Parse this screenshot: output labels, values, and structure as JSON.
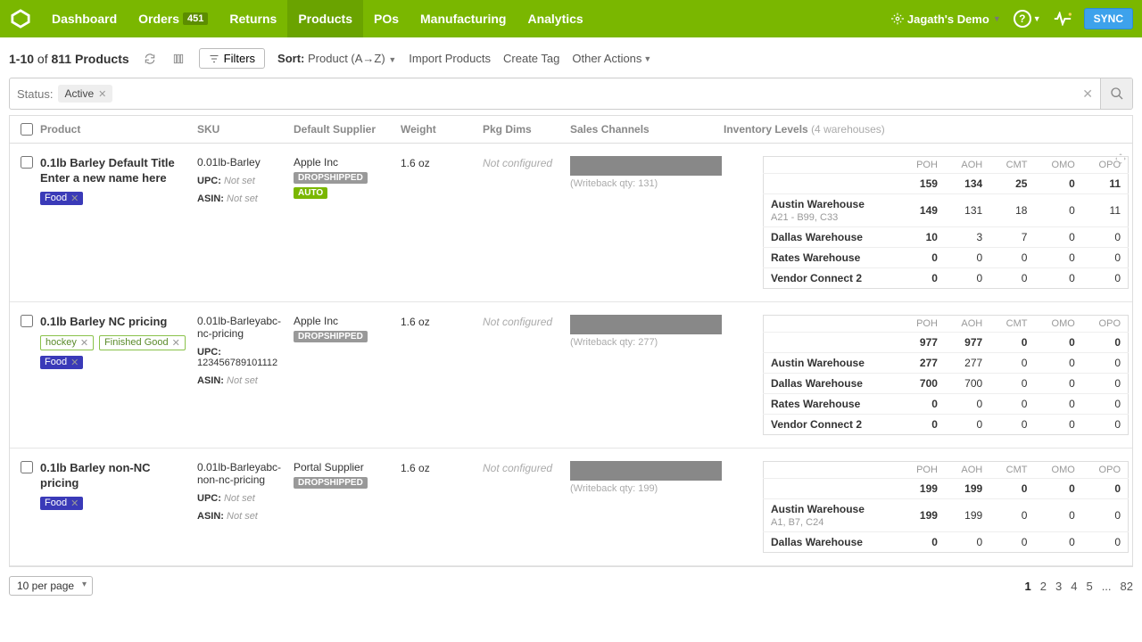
{
  "nav": {
    "items": [
      {
        "label": "Dashboard"
      },
      {
        "label": "Orders",
        "badge": "451"
      },
      {
        "label": "Returns"
      },
      {
        "label": "Products",
        "active": true
      },
      {
        "label": "POs"
      },
      {
        "label": "Manufacturing"
      },
      {
        "label": "Analytics"
      }
    ],
    "demo_label": "Jagath's Demo",
    "sync": "SYNC"
  },
  "toolbar": {
    "count_range": "1-10",
    "of": " of ",
    "total": "811 Products",
    "filters": "Filters",
    "sort_label": "Sort:",
    "sort_value": "Product (A→Z)",
    "import": "Import Products",
    "create_tag": "Create Tag",
    "other": "Other Actions"
  },
  "search": {
    "status_label": "Status:",
    "status_value": "Active"
  },
  "headers": {
    "product": "Product",
    "sku": "SKU",
    "supplier": "Default Supplier",
    "weight": "Weight",
    "pkg": "Pkg Dims",
    "sales": "Sales Channels",
    "inv": "Inventory Levels",
    "wh_count": "(4 warehouses)"
  },
  "inv_cols": [
    "",
    "POH",
    "AOH",
    "CMT",
    "OMO",
    "OPO"
  ],
  "warehouses": [
    "Austin Warehouse",
    "Dallas Warehouse",
    "Rates Warehouse",
    "Vendor Connect 2"
  ],
  "rows": [
    {
      "name": "0.1lb Barley Default Title Enter a new name here",
      "tags": [
        {
          "t": "Food",
          "cls": "tag-food"
        }
      ],
      "sku": "0.01lb-Barley",
      "upc": "Not set",
      "asin": "Not set",
      "supplier": "Apple Inc",
      "badges": [
        "DROPSHIPPED",
        "AUTO"
      ],
      "weight": "1.6 oz",
      "pkg": "Not configured",
      "wbq": "(Writeback qty: 131)",
      "totals": [
        159,
        134,
        25,
        0,
        11
      ],
      "wh": [
        {
          "name": "Austin Warehouse",
          "loc": "A21 - B99, C33",
          "v": [
            149,
            131,
            18,
            0,
            11
          ]
        },
        {
          "name": "Dallas Warehouse",
          "v": [
            10,
            3,
            7,
            0,
            0
          ]
        },
        {
          "name": "Rates Warehouse",
          "v": [
            0,
            0,
            0,
            0,
            0
          ]
        },
        {
          "name": "Vendor Connect 2",
          "v": [
            0,
            0,
            0,
            0,
            0
          ]
        }
      ]
    },
    {
      "name": "0.1lb Barley NC pricing",
      "tags": [
        {
          "t": "hockey",
          "cls": "tag-hockey"
        },
        {
          "t": "Finished Good",
          "cls": "tag-fg"
        },
        {
          "t": "Food",
          "cls": "tag-food"
        }
      ],
      "sku": "0.01lb-Barleyabc-nc-pricing",
      "upc": "123456789101112",
      "asin": "Not set",
      "supplier": "Apple Inc",
      "badges": [
        "DROPSHIPPED"
      ],
      "weight": "1.6 oz",
      "pkg": "Not configured",
      "wbq": "(Writeback qty: 277)",
      "totals": [
        977,
        977,
        0,
        0,
        0
      ],
      "wh": [
        {
          "name": "Austin Warehouse",
          "v": [
            277,
            277,
            0,
            0,
            0
          ]
        },
        {
          "name": "Dallas Warehouse",
          "v": [
            700,
            700,
            0,
            0,
            0
          ]
        },
        {
          "name": "Rates Warehouse",
          "v": [
            0,
            0,
            0,
            0,
            0
          ]
        },
        {
          "name": "Vendor Connect 2",
          "v": [
            0,
            0,
            0,
            0,
            0
          ]
        }
      ]
    },
    {
      "name": "0.1lb Barley non-NC pricing",
      "tags": [
        {
          "t": "Food",
          "cls": "tag-food"
        }
      ],
      "sku": "0.01lb-Barleyabc-non-nc-pricing",
      "upc": "Not set",
      "asin": "Not set",
      "supplier": "Portal Supplier",
      "badges": [
        "DROPSHIPPED"
      ],
      "weight": "1.6 oz",
      "pkg": "Not configured",
      "wbq": "(Writeback qty: 199)",
      "totals": [
        199,
        199,
        0,
        0,
        0
      ],
      "wh": [
        {
          "name": "Austin Warehouse",
          "loc": "A1, B7, C24",
          "v": [
            199,
            199,
            0,
            0,
            0
          ]
        },
        {
          "name": "Dallas Warehouse",
          "v": [
            0,
            0,
            0,
            0,
            0
          ]
        }
      ]
    }
  ],
  "footer": {
    "perpage": "10 per page",
    "pages": [
      "1",
      "2",
      "3",
      "4",
      "5",
      "...",
      "82"
    ]
  },
  "labels": {
    "upc": "UPC:",
    "asin": "ASIN:",
    "notset": "Not set"
  }
}
